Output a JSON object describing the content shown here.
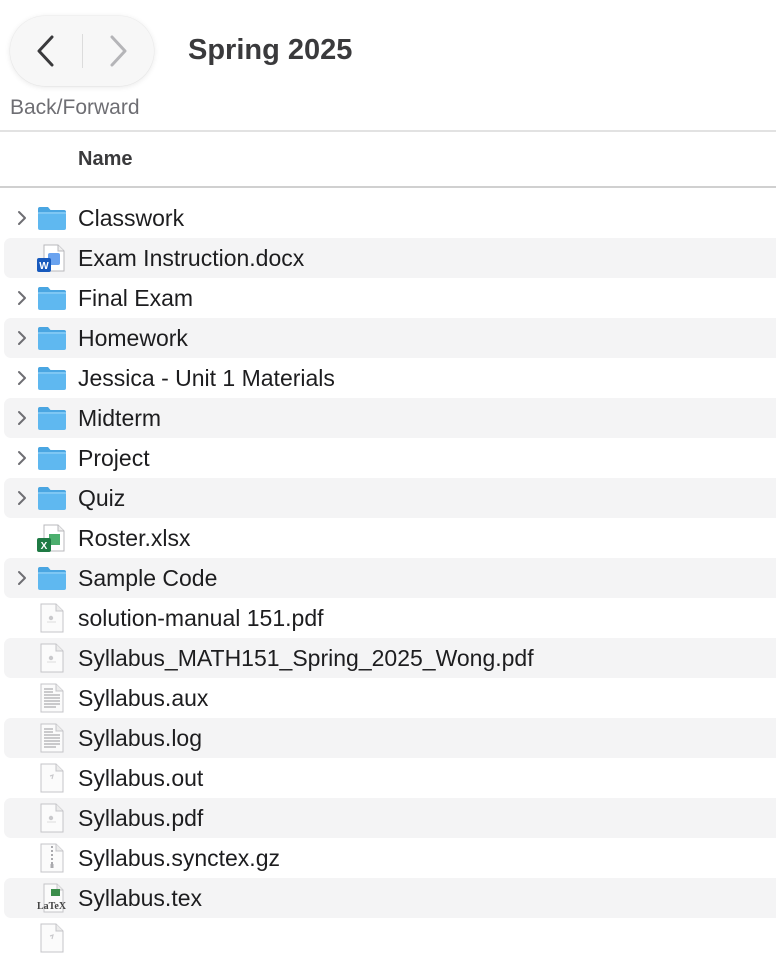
{
  "window": {
    "title": "Spring 2025"
  },
  "navigation": {
    "back": "back",
    "forward": "forward",
    "caption": "Back/Forward"
  },
  "columns": {
    "name": "Name"
  },
  "items": [
    {
      "name": "Classwork",
      "kind": "folder",
      "expandable": true
    },
    {
      "name": "Exam Instruction.docx",
      "kind": "word",
      "expandable": false
    },
    {
      "name": "Final Exam",
      "kind": "folder",
      "expandable": true
    },
    {
      "name": "Homework",
      "kind": "folder",
      "expandable": true
    },
    {
      "name": "Jessica - Unit 1 Materials",
      "kind": "folder",
      "expandable": true
    },
    {
      "name": "Midterm",
      "kind": "folder",
      "expandable": true
    },
    {
      "name": "Project",
      "kind": "folder",
      "expandable": true
    },
    {
      "name": "Quiz",
      "kind": "folder",
      "expandable": true
    },
    {
      "name": "Roster.xlsx",
      "kind": "excel",
      "expandable": false
    },
    {
      "name": "Sample Code",
      "kind": "folder",
      "expandable": true
    },
    {
      "name": "solution-manual 151.pdf",
      "kind": "pdf",
      "expandable": false
    },
    {
      "name": "Syllabus_MATH151_Spring_2025_Wong.pdf",
      "kind": "pdf",
      "expandable": false
    },
    {
      "name": "Syllabus.aux",
      "kind": "text",
      "expandable": false
    },
    {
      "name": "Syllabus.log",
      "kind": "text",
      "expandable": false
    },
    {
      "name": "Syllabus.out",
      "kind": "generic",
      "expandable": false
    },
    {
      "name": "Syllabus.pdf",
      "kind": "pdf",
      "expandable": false
    },
    {
      "name": "Syllabus.synctex.gz",
      "kind": "archive",
      "expandable": false
    },
    {
      "name": "Syllabus.tex",
      "kind": "tex",
      "expandable": false
    },
    {
      "name": "",
      "kind": "generic",
      "expandable": false
    }
  ],
  "colors": {
    "folder": "#5fb8f0",
    "folder_tab": "#4aa6e2",
    "word": "#185abd",
    "excel": "#1f7a44",
    "row_alt": "#f4f4f5"
  }
}
